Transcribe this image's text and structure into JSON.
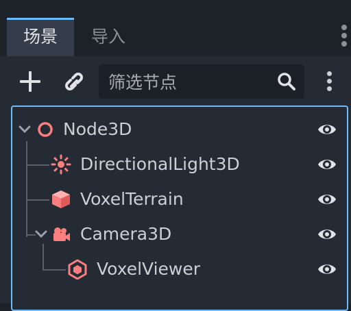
{
  "tabs": [
    {
      "label": "场景",
      "active": true
    },
    {
      "label": "导入",
      "active": false
    }
  ],
  "toolbar": {
    "add_icon": "plus-icon",
    "link_icon": "link-icon",
    "search_placeholder": "筛选节点",
    "search_icon": "search-icon",
    "menu_icon": "kebab-menu-icon"
  },
  "tree": {
    "nodes": [
      {
        "name": "Node3D",
        "icon": "node3d-circle-icon",
        "expanded": true,
        "visible": true
      },
      {
        "name": "DirectionalLight3D",
        "icon": "sun-light-icon",
        "visible": true
      },
      {
        "name": "VoxelTerrain",
        "icon": "cube-icon",
        "visible": true
      },
      {
        "name": "Camera3D",
        "icon": "camera-icon",
        "expanded": true,
        "visible": true
      },
      {
        "name": "VoxelViewer",
        "icon": "voxel-viewer-icon",
        "visible": true
      }
    ]
  },
  "colors": {
    "accent": "#70bafa",
    "node3d_icon": "#fc7f7f",
    "panel_bg": "#252b34",
    "dock_bg": "#1d2229"
  }
}
